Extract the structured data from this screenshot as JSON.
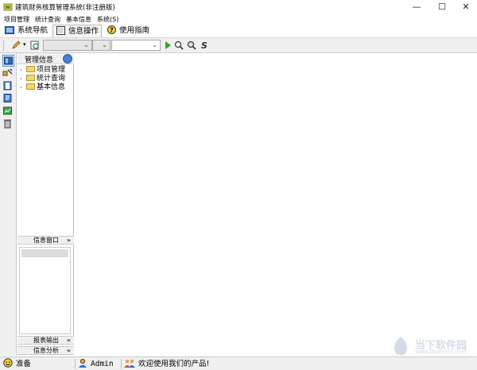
{
  "window": {
    "title": "建筑财务核算管理系统(非注册版)",
    "minimize": "—",
    "maximize": "☐",
    "close": "✕"
  },
  "menu": [
    "项目管理",
    "统计查询",
    "基本信息",
    "系统(S)"
  ],
  "tabs": [
    {
      "label": "系统导航",
      "icon": "navigation-icon"
    },
    {
      "label": "信息操作",
      "icon": "document-icon"
    },
    {
      "label": "使用指南",
      "icon": "help-icon"
    }
  ],
  "active_tab": "信息操作",
  "toolbar": {
    "combo1_value": "",
    "combo2_value": "",
    "combo3_value": ""
  },
  "tree_panel": {
    "title": "管理信息",
    "items": [
      "项目管理",
      "统计查询",
      "基本信息"
    ]
  },
  "sections": {
    "info_window": "信息窗口",
    "report_output": "报表输出",
    "info_analysis": "信息分析"
  },
  "status": {
    "ready": "准备",
    "user": "Admin",
    "welcome": "欢迎使用我们的产品!"
  },
  "watermark": {
    "text": "当下软件园",
    "url": "www.downxia.com"
  }
}
